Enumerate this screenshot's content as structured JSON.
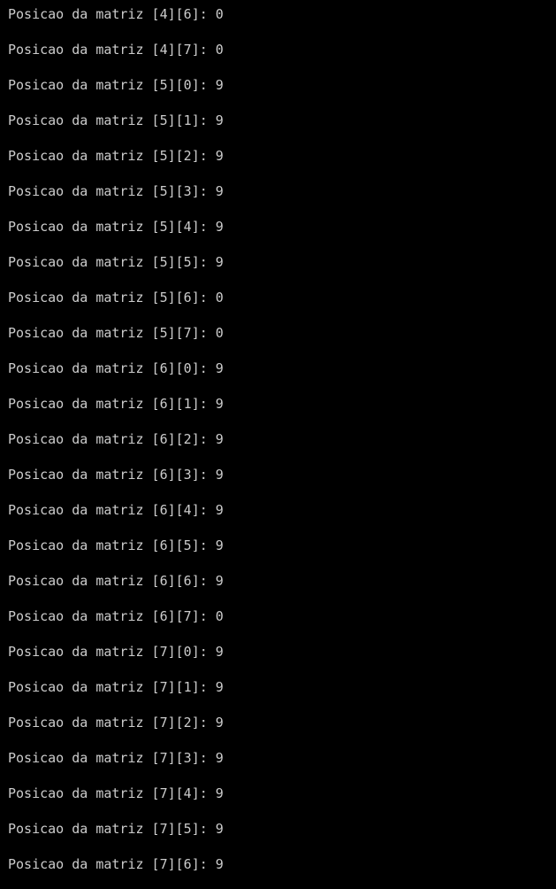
{
  "console": {
    "background": "#000000",
    "text_color": "#cccccc",
    "lines": [
      "Posicao da matriz [4][6]: 0",
      "Posicao da matriz [4][7]: 0",
      "Posicao da matriz [5][0]: 9",
      "Posicao da matriz [5][1]: 9",
      "Posicao da matriz [5][2]: 9",
      "Posicao da matriz [5][3]: 9",
      "Posicao da matriz [5][4]: 9",
      "Posicao da matriz [5][5]: 9",
      "Posicao da matriz [5][6]: 0",
      "Posicao da matriz [5][7]: 0",
      "Posicao da matriz [6][0]: 9",
      "Posicao da matriz [6][1]: 9",
      "Posicao da matriz [6][2]: 9",
      "Posicao da matriz [6][3]: 9",
      "Posicao da matriz [6][4]: 9",
      "Posicao da matriz [6][5]: 9",
      "Posicao da matriz [6][6]: 9",
      "Posicao da matriz [6][7]: 0",
      "Posicao da matriz [7][0]: 9",
      "Posicao da matriz [7][1]: 9",
      "Posicao da matriz [7][2]: 9",
      "Posicao da matriz [7][3]: 9",
      "Posicao da matriz [7][4]: 9",
      "Posicao da matriz [7][5]: 9",
      "Posicao da matriz [7][6]: 9"
    ]
  }
}
